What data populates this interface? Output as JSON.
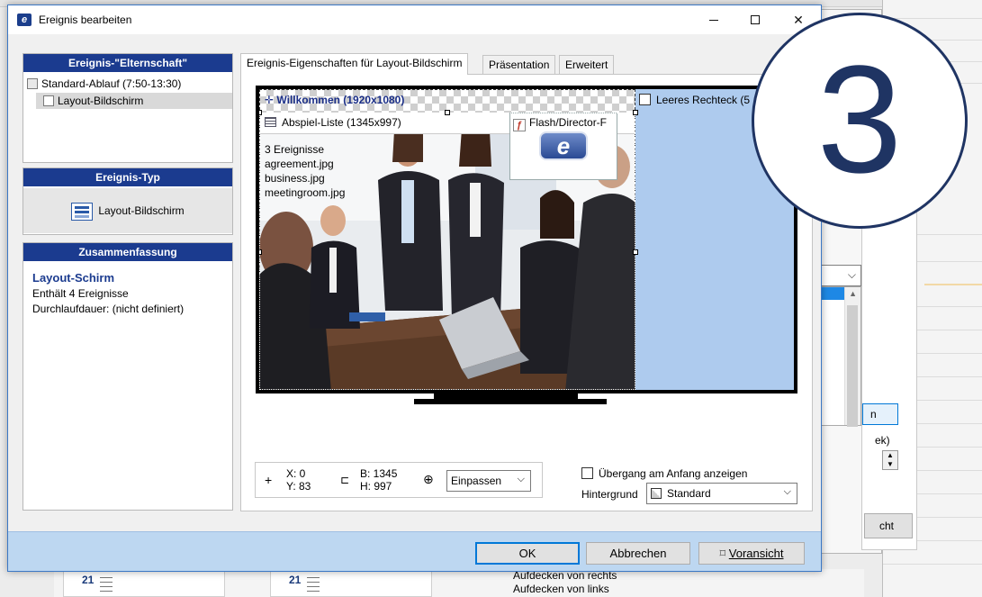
{
  "dialog": {
    "title": "Ereignis bearbeiten",
    "close_glyph": "✕"
  },
  "left": {
    "parent_header": "Ereignis-\"Elternschaft\"",
    "tree": [
      {
        "label": "Standard-Ablauf (7:50-13:30)"
      },
      {
        "label": "Layout-Bildschirm"
      }
    ],
    "type_header": "Ereignis-Typ",
    "type_label": "Layout-Bildschirm",
    "summary_header": "Zusammenfassung",
    "summary_title": "Layout-Schirm",
    "summary_lines": [
      "Enthält 4 Ereignisse",
      "Durchlaufdauer: (nicht definiert)"
    ]
  },
  "tabs": [
    {
      "label": "Ereignis-Eigenschaften für Layout-Bildschirm",
      "active": true
    },
    {
      "label": "Präsentation",
      "active": false
    },
    {
      "label": "Erweitert",
      "active": false
    }
  ],
  "preview": {
    "welcome_label": "Willkommen (1920x1080)",
    "playlist_label": "Abspiel-Liste (1345x997)",
    "playlist_info": [
      "3 Ereignisse",
      "agreement.jpg",
      "business.jpg",
      "meetingroom.jpg"
    ],
    "flash_label": "Flash/Director-F",
    "rect_label": "Leeres Rechteck (5"
  },
  "toolbar": {
    "x_label": "X: 0",
    "y_label": "Y: 83",
    "w_label": "B: 1345",
    "h_label": "H: 997",
    "zoom_value": "Einpassen",
    "transition_label": "Übergang am Anfang anzeigen",
    "background_label": "Hintergrund",
    "background_value": "Standard"
  },
  "buttons": {
    "ok": "OK",
    "cancel": "Abbrechen",
    "preview": "Voransicht"
  },
  "badge": {
    "number": "3"
  },
  "background_app": {
    "button_fragment": "n",
    "text_fragment": "ek)",
    "button_fragment2": "cht",
    "cal_numbers": [
      "21",
      "21"
    ],
    "list_lines": [
      "Aufdecken von rechts",
      "Aufdecken von links"
    ]
  },
  "colors": {
    "panel_header": "#1b3b8f",
    "footer": "#bdd7f1",
    "badge": "#1f3463",
    "screen_bg": "#aecbee"
  }
}
